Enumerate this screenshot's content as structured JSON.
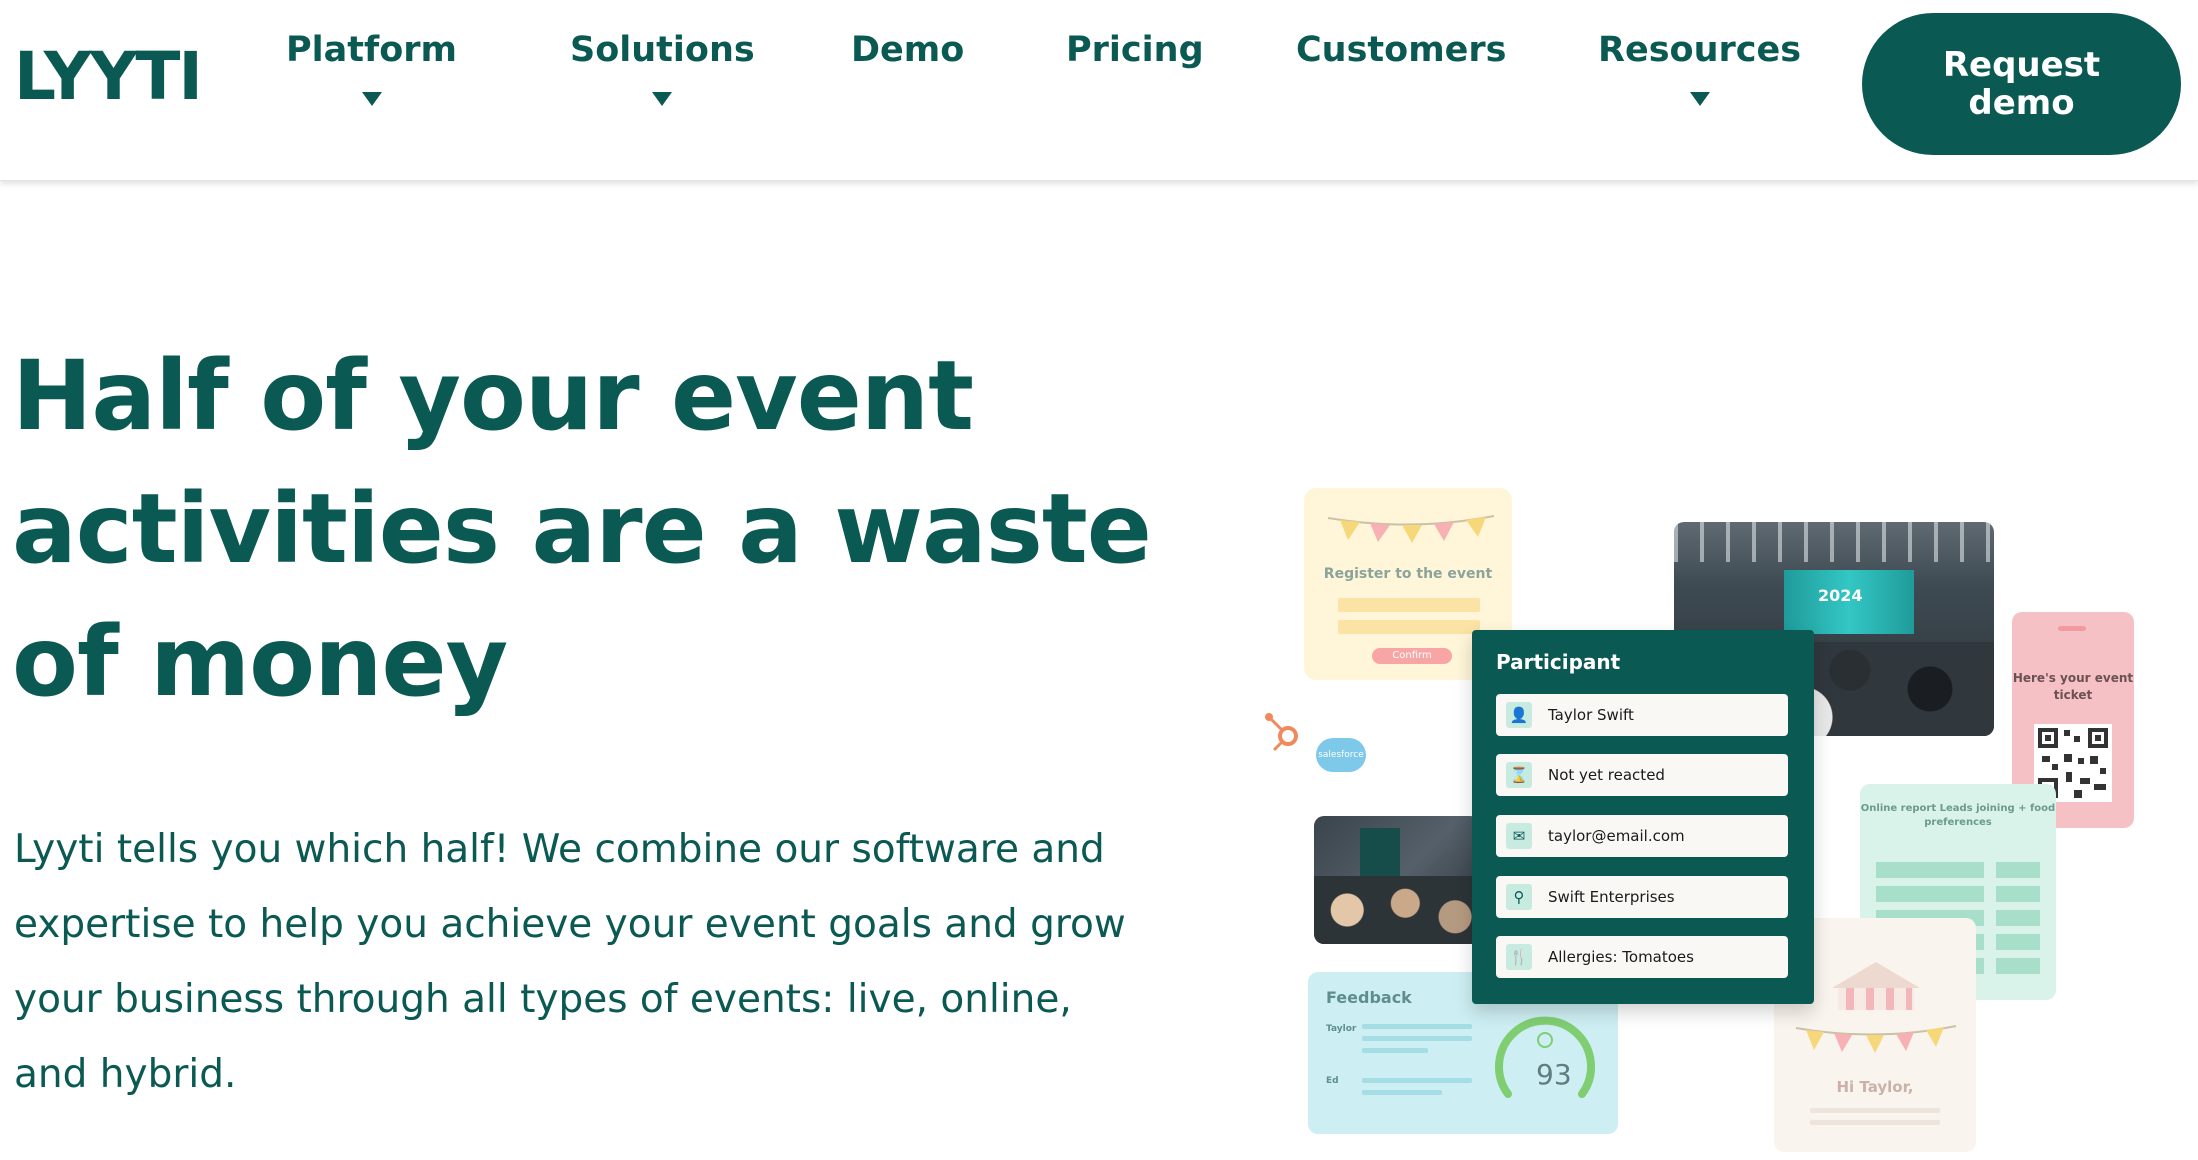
{
  "brand": {
    "logo_text": "LYYTI",
    "primary_color": "#0b5953"
  },
  "nav": {
    "items": [
      {
        "label": "Platform",
        "has_dropdown": true
      },
      {
        "label": "Solutions",
        "has_dropdown": true
      },
      {
        "label": "Demo",
        "has_dropdown": false
      },
      {
        "label": "Pricing",
        "has_dropdown": false
      },
      {
        "label": "Customers",
        "has_dropdown": false
      },
      {
        "label": "Resources",
        "has_dropdown": true
      }
    ],
    "cta_label": "Request demo"
  },
  "hero": {
    "title": "Half of your event activities are a waste of money",
    "subtitle": "Lyyti tells you which half! We combine our software and expertise to help you achieve your event goals and grow your business through all types of events: live, online, and hybrid."
  },
  "illustration": {
    "register_card": {
      "title": "Register to the event",
      "button": "Confirm"
    },
    "integrations": {
      "salesforce_label": "salesforce"
    },
    "event_photo_screen_text": "2024",
    "participant": {
      "title": "Participant",
      "rows": [
        {
          "icon": "person-icon",
          "glyph": "👤",
          "text": "Taylor Swift"
        },
        {
          "icon": "person-status-icon",
          "glyph": "⌛",
          "text": "Not yet reacted"
        },
        {
          "icon": "envelope-icon",
          "glyph": "✉",
          "text": "taylor@email.com"
        },
        {
          "icon": "search-company-icon",
          "glyph": "⚲",
          "text": "Swift Enterprises"
        },
        {
          "icon": "cutlery-icon",
          "glyph": "🍴",
          "text": "Allergies: Tomatoes"
        }
      ]
    },
    "ticket": {
      "text": "Here's your event ticket"
    },
    "report": {
      "text": "Online report Leads joining + food preferences"
    },
    "feedback": {
      "title": "Feedback",
      "names": [
        "Taylor",
        "Ed"
      ],
      "score": "93"
    },
    "greeting": {
      "text": "Hi Taylor,"
    },
    "colors": {
      "yellow": "#fff6d9",
      "pink": "#f6c1c4",
      "mint": "#d9f2ea",
      "cyan": "#cdeff3",
      "cream": "#faf4ee",
      "gauge": "#7fce72"
    }
  }
}
